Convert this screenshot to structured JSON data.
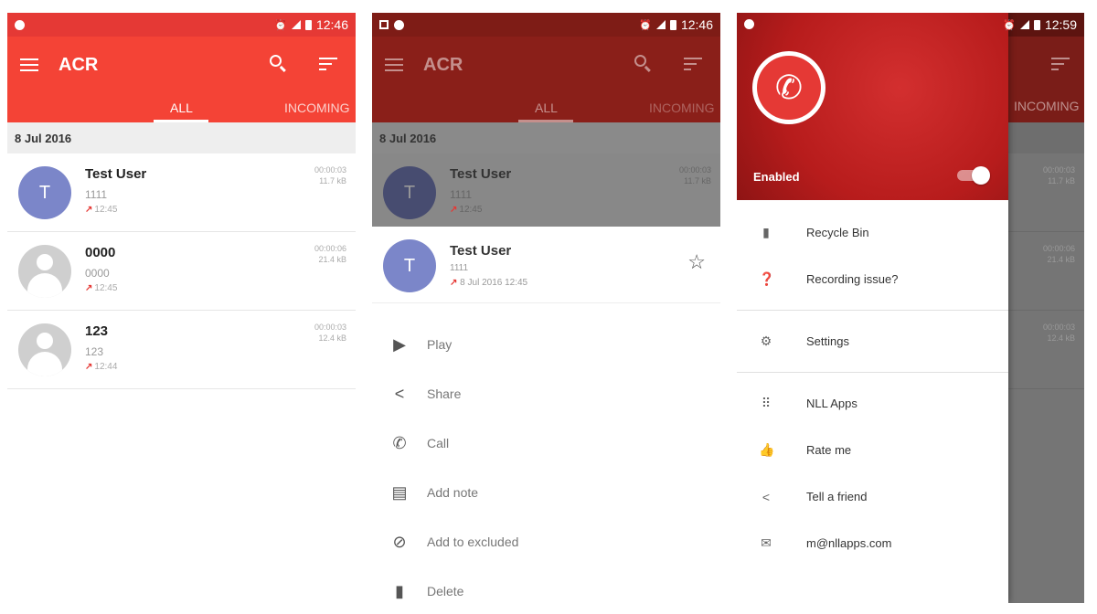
{
  "colors": {
    "accent": "#f44336",
    "drawer": "#b71c1c",
    "arrow": "#e53935"
  },
  "status": {
    "time1": "12:46",
    "time2": "12:46",
    "time3": "12:59"
  },
  "app": {
    "title": "ACR"
  },
  "tabs": {
    "all": "ALL",
    "incoming": "INCOMING"
  },
  "list": {
    "date_header": "8 Jul 2016",
    "calls": [
      {
        "initial": "T",
        "name": "Test User",
        "number": "1111",
        "time": "12:45",
        "duration": "00:00:03",
        "size": "11.7 kB"
      },
      {
        "initial": "",
        "name": "0000",
        "number": "0000",
        "time": "12:45",
        "duration": "00:00:06",
        "size": "21.4 kB"
      },
      {
        "initial": "",
        "name": "123",
        "number": "123",
        "time": "12:44",
        "duration": "00:00:03",
        "size": "12.4 kB"
      }
    ]
  },
  "sheet": {
    "initial": "T",
    "name": "Test User",
    "number": "1111",
    "datetime": "8 Jul 2016 12:45",
    "actions": [
      {
        "icon": "play-icon",
        "label": "Play"
      },
      {
        "icon": "share-icon",
        "label": "Share"
      },
      {
        "icon": "call-icon",
        "label": "Call"
      },
      {
        "icon": "note-icon",
        "label": "Add note"
      },
      {
        "icon": "block-icon",
        "label": "Add to excluded"
      },
      {
        "icon": "delete-icon",
        "label": "Delete"
      }
    ]
  },
  "drawer": {
    "enabled_label": "Enabled",
    "items": [
      {
        "icon": "trash-icon",
        "label": "Recycle Bin"
      },
      {
        "icon": "help-icon",
        "label": "Recording issue?"
      },
      {
        "icon": "gear-icon",
        "label": "Settings"
      },
      {
        "icon": "apps-icon",
        "label": "NLL Apps"
      },
      {
        "icon": "thumbs-up-icon",
        "label": "Rate me"
      },
      {
        "icon": "share-icon",
        "label": "Tell a friend"
      },
      {
        "icon": "mail-icon",
        "label": "m@nllapps.com"
      }
    ]
  }
}
